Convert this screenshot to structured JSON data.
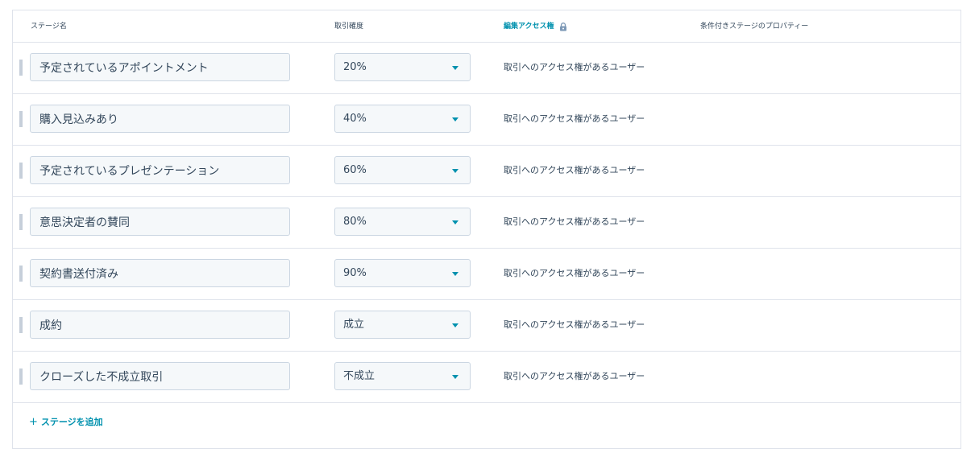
{
  "header": {
    "stage_name": "ステージ名",
    "probability": "取引確度",
    "edit_access": "編集アクセス権",
    "conditional_properties": "条件付きステージのプロパティー"
  },
  "stages": [
    {
      "name": "予定されているアポイントメント",
      "probability": "20%",
      "access": "取引へのアクセス権があるユーザー"
    },
    {
      "name": "購入見込みあり",
      "probability": "40%",
      "access": "取引へのアクセス権があるユーザー"
    },
    {
      "name": "予定されているプレゼンテーション",
      "probability": "60%",
      "access": "取引へのアクセス権があるユーザー"
    },
    {
      "name": "意思決定者の賛同",
      "probability": "80%",
      "access": "取引へのアクセス権があるユーザー"
    },
    {
      "name": "契約書送付済み",
      "probability": "90%",
      "access": "取引へのアクセス権があるユーザー"
    },
    {
      "name": "成約",
      "probability": "成立",
      "access": "取引へのアクセス権があるユーザー"
    },
    {
      "name": "クローズした不成立取引",
      "probability": "不成立",
      "access": "取引へのアクセス権があるユーザー"
    }
  ],
  "add_stage": {
    "icon": "+",
    "label": "ステージを追加"
  },
  "colors": {
    "accent": "#0091ae",
    "text": "#33475b",
    "border": "#dfe3eb",
    "input_bg": "#f5f8fa"
  },
  "icons": {
    "lock": "lock-icon",
    "caret": "caret-down-icon",
    "drag": "drag-handle-icon"
  }
}
